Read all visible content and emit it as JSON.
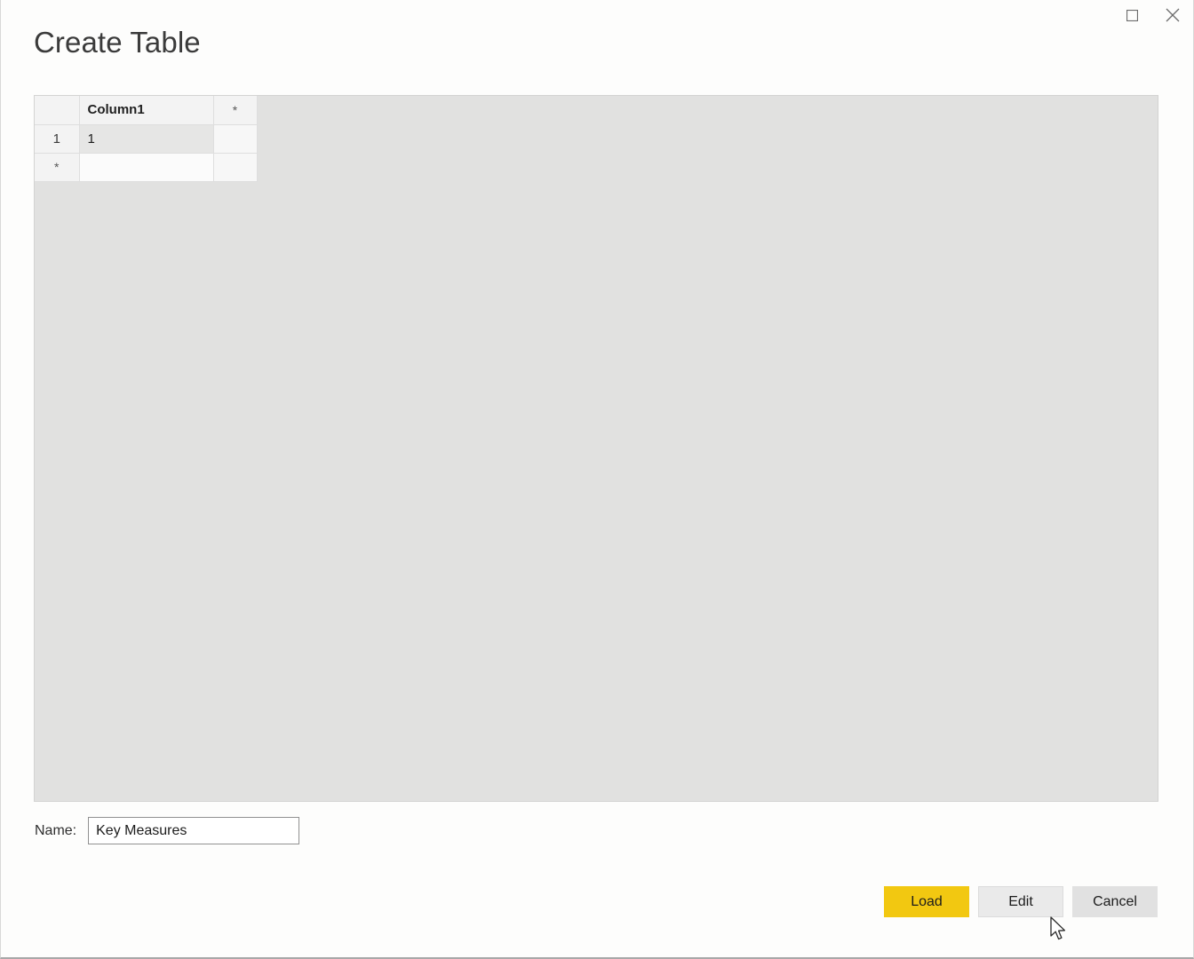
{
  "window": {
    "title": "Create Table",
    "controls": [
      {
        "name": "maximize",
        "icon": "square-icon",
        "label": "Maximize"
      },
      {
        "name": "close",
        "icon": "close-icon",
        "label": "Close"
      }
    ]
  },
  "grid": {
    "corner_label": "",
    "columns": [
      {
        "label": "Column1",
        "type": "data"
      },
      {
        "label": "*",
        "type": "new-column"
      }
    ],
    "rows": [
      {
        "header": "1",
        "cells": [
          "1",
          ""
        ],
        "selected_cell": 0
      },
      {
        "header": "*",
        "cells": [
          "",
          ""
        ],
        "selected_cell": -1
      }
    ]
  },
  "name_field": {
    "label": "Name:",
    "value": "Key Measures",
    "placeholder": ""
  },
  "footer": {
    "load_label": "Load",
    "edit_label": "Edit",
    "cancel_label": "Cancel"
  },
  "colors": {
    "accent": "#f2c811",
    "panel_background": "#e1e1e0",
    "dialog_background": "#fdfdfc",
    "button_secondary": "#e1e1e1",
    "title_text": "#3b3b3b"
  }
}
